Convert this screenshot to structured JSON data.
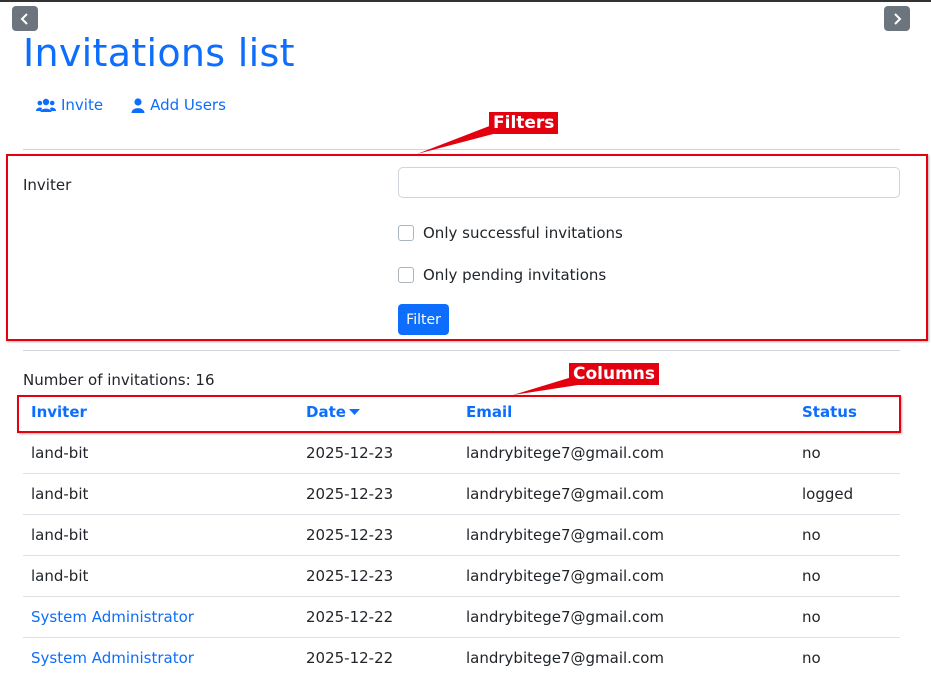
{
  "nav": {
    "prev_icon": "chevron-left-icon",
    "next_icon": "chevron-right-icon"
  },
  "page": {
    "title": "Invitations list"
  },
  "actions": [
    {
      "label": "Invite",
      "icon": "users-icon"
    },
    {
      "label": "Add Users",
      "icon": "user-icon"
    }
  ],
  "annotations": {
    "filters": "Filters",
    "columns": "Columns"
  },
  "filters": {
    "inviter_label": "Inviter",
    "inviter_value": "",
    "inviter_placeholder": "",
    "only_successful": "Only successful invitations",
    "only_pending": "Only pending invitations",
    "filter_button": "Filter"
  },
  "count_text": "Number of invitations: 16",
  "table": {
    "headers": [
      "Inviter",
      "Date",
      "Email",
      "Status"
    ],
    "sort_column": "Date",
    "sort_icon": "caret-down-icon",
    "rows": [
      {
        "inviter": "land-bit",
        "date": "2025-12-23",
        "email": "landrybitege7@gmail.com",
        "status": "no"
      },
      {
        "inviter": "land-bit",
        "date": "2025-12-23",
        "email": "landrybitege7@gmail.com",
        "status": "logged"
      },
      {
        "inviter": "land-bit",
        "date": "2025-12-23",
        "email": "landrybitege7@gmail.com",
        "status": "no"
      },
      {
        "inviter": "land-bit",
        "date": "2025-12-23",
        "email": "landrybitege7@gmail.com",
        "status": "no"
      },
      {
        "inviter": "System Administrator",
        "date": "2025-12-22",
        "email": "landrybitege7@gmail.com",
        "status": "no"
      },
      {
        "inviter": "System Administrator",
        "date": "2025-12-22",
        "email": "landrybitege7@gmail.com",
        "status": "no"
      }
    ]
  },
  "colors": {
    "accent": "#0d6efd",
    "annotation": "#e3000f",
    "nav_button": "#6c757d"
  }
}
